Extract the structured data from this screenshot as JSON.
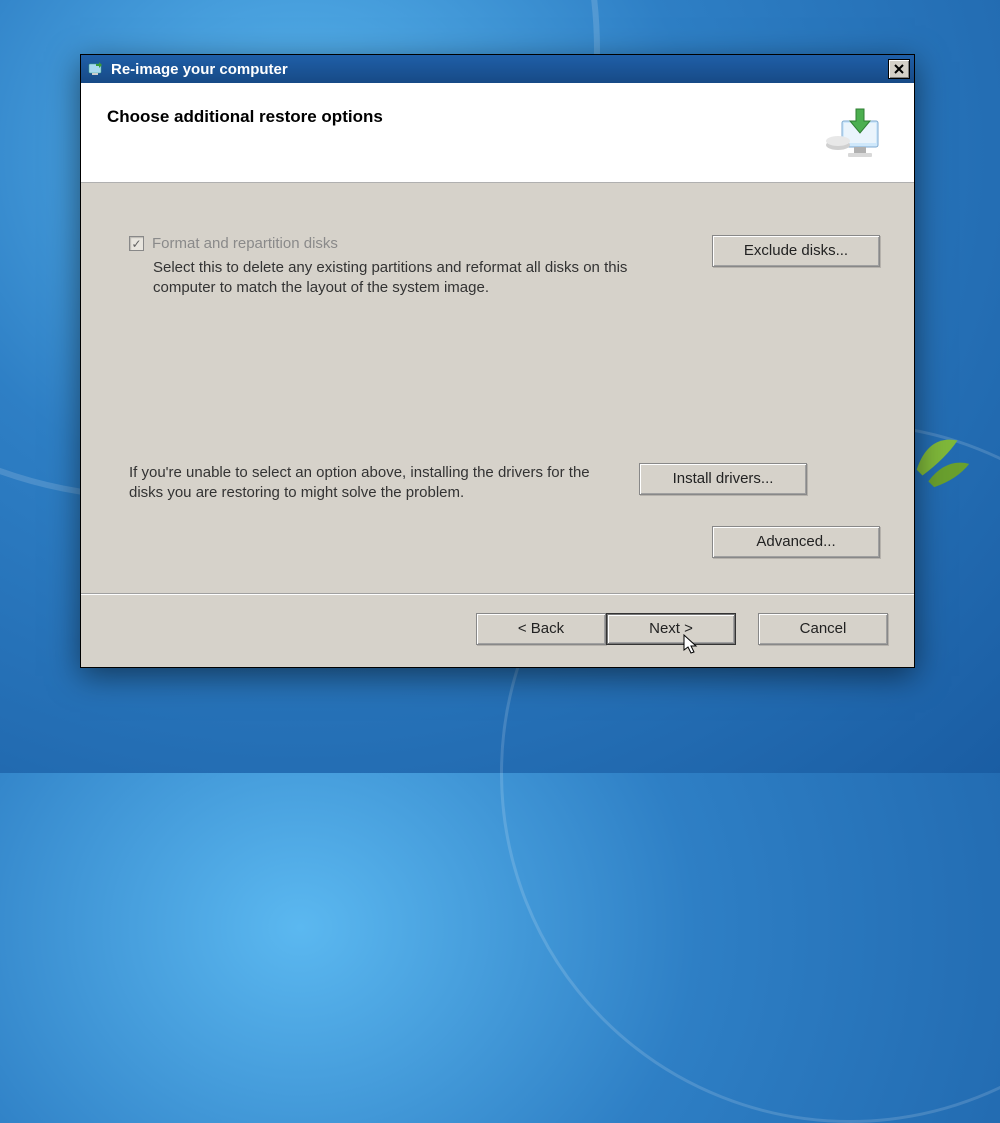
{
  "window": {
    "title": "Re-image your computer"
  },
  "header": {
    "title": "Choose additional restore options"
  },
  "options": {
    "format_checkbox_label": "Format and repartition disks",
    "format_description": "Select this to delete any existing partitions and reformat all disks on this computer to match the layout of the system image.",
    "drivers_description": "If you're unable to select an option above, installing the drivers for the disks you are restoring to might solve the problem."
  },
  "buttons": {
    "exclude_disks": "Exclude disks...",
    "install_drivers": "Install drivers...",
    "advanced": "Advanced...",
    "back": "< Back",
    "next": "Next >",
    "cancel": "Cancel"
  }
}
